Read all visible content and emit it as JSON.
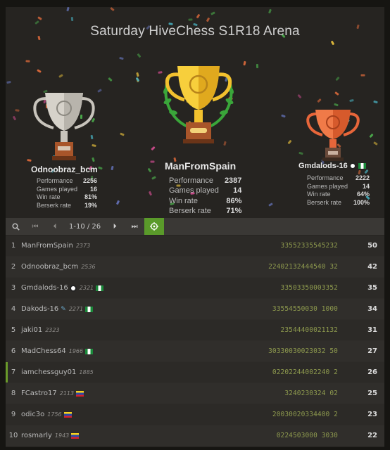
{
  "tournament": {
    "title": "Saturday HiveChess S1R18 Arena"
  },
  "stats_labels": {
    "performance": "Performance",
    "games_played": "Games played",
    "win_rate": "Win rate",
    "berserk_rate": "Berserk rate"
  },
  "podium": {
    "first": {
      "name": "ManFromSpain",
      "performance": "2387",
      "games_played": "14",
      "win_rate": "86%",
      "berserk_rate": "71%"
    },
    "second": {
      "name": "Odnoobraz_bcm",
      "performance": "2256",
      "games_played": "16",
      "win_rate": "81%",
      "berserk_rate": "19%"
    },
    "third": {
      "name": "Gmdalods-16",
      "performance": "2222",
      "games_played": "14",
      "win_rate": "64%",
      "berserk_rate": "100%"
    }
  },
  "pager": {
    "page_info": "1-10 / 26"
  },
  "standings": [
    {
      "rank": "1",
      "name": "ManFromSpain",
      "rating": "2373",
      "sheet": "33552335545232",
      "score": "50"
    },
    {
      "rank": "2",
      "name": "Odnoobraz_bcm",
      "rating": "2536",
      "sheet": "22402132444540 32",
      "score": "42"
    },
    {
      "rank": "3",
      "name": "Gmdalods-16",
      "rating": "2321",
      "sheet": "33503350003352",
      "score": "35"
    },
    {
      "rank": "4",
      "name": "Dakods-16",
      "rating": "2271",
      "sheet": "33554550030 1000",
      "score": "34"
    },
    {
      "rank": "5",
      "name": "jaki01",
      "rating": "2323",
      "sheet": "23544400021132",
      "score": "31"
    },
    {
      "rank": "6",
      "name": "MadChess64",
      "rating": "1966",
      "sheet": "30330030023032 50",
      "score": "27"
    },
    {
      "rank": "7",
      "name": "iamchessguy01",
      "rating": "1885",
      "sheet": "02202244002240 2",
      "score": "26"
    },
    {
      "rank": "8",
      "name": "FCastro17",
      "rating": "2113",
      "sheet": "3240230324 02",
      "score": "25"
    },
    {
      "rank": "9",
      "name": "odic3o",
      "rating": "1756",
      "sheet": "20030020334400 2",
      "score": "23"
    },
    {
      "rank": "10",
      "name": "rosmarly",
      "rating": "1943",
      "sheet": "0224503000 3030",
      "score": "22"
    }
  ],
  "colors": {
    "accent_green": "#5a9a2a",
    "gold": "#f2c12e",
    "silver": "#c8c4bc",
    "bronze": "#e8663a"
  }
}
